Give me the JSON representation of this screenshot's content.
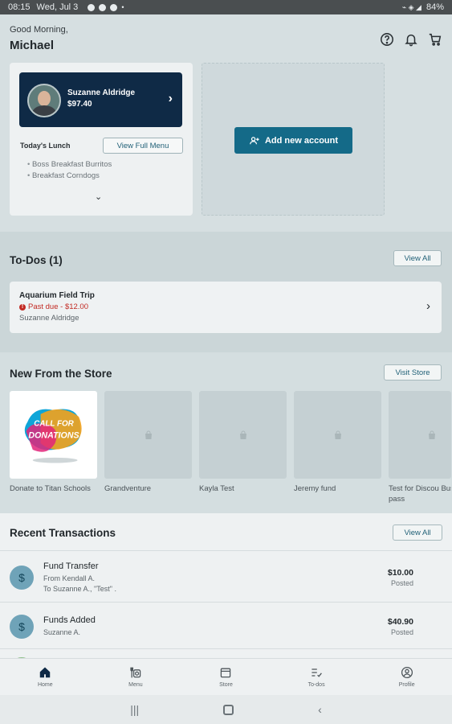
{
  "status_bar": {
    "time": "08:15",
    "date": "Wed, Jul 3",
    "battery": "84%"
  },
  "header": {
    "greeting": "Good Morning,",
    "user_name": "Michael"
  },
  "student_card": {
    "name": "Suzanne Aldridge",
    "balance": "$97.40"
  },
  "lunch": {
    "title": "Today's Lunch",
    "view_menu_label": "View Full Menu",
    "items": [
      "Boss Breakfast Burritos",
      "Breakfast Corndogs"
    ]
  },
  "add_account": {
    "label": "Add new account"
  },
  "todos": {
    "title": "To-Dos (1)",
    "view_all": "View All",
    "item": {
      "title": "Aquarium Field Trip",
      "status": "Past due - $12.00",
      "student": "Suzanne Aldridge"
    }
  },
  "store": {
    "title": "New From the Store",
    "visit_label": "Visit Store",
    "products": [
      {
        "name": "Donate to Titan Schools",
        "art_text": "CALL FOR DONATIONS"
      },
      {
        "name": "Grandventure"
      },
      {
        "name": "Kayla Test"
      },
      {
        "name": "Jeremy fund"
      },
      {
        "name": "Test for Discou Bus pass"
      }
    ]
  },
  "transactions": {
    "title": "Recent Transactions",
    "view_all": "View All",
    "items": [
      {
        "title": "Fund Transfer",
        "line1": "From Kendall A.",
        "line2": "To Suzanne A., \"Test\" .",
        "amount": "$10.00",
        "status": "Posted"
      },
      {
        "title": "Funds Added",
        "line1": "Suzanne A.",
        "line2": "",
        "amount": "$40.90",
        "status": "Posted"
      }
    ]
  },
  "nav": {
    "home": "Home",
    "menu": "Menu",
    "store": "Store",
    "todos": "To-dos",
    "profile": "Profile"
  },
  "colors": {
    "primary": "#146a88",
    "navy": "#0f2a46",
    "danger": "#c22a23"
  }
}
